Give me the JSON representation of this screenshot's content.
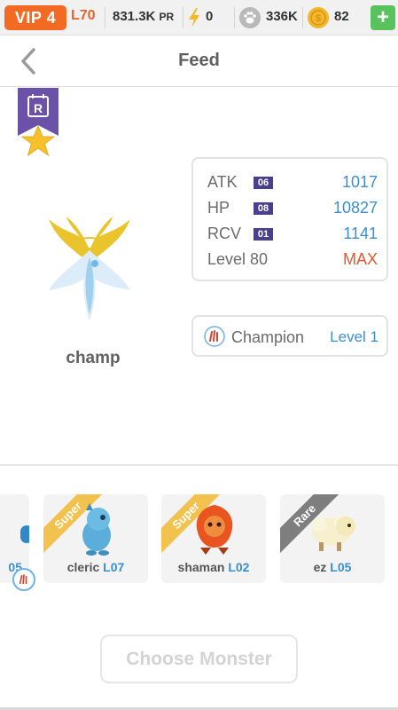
{
  "topbar": {
    "vip": "VIP 4",
    "level": "L70",
    "power": "831.3K",
    "power_suffix": "PR",
    "energy": "0",
    "paw": "336K",
    "coins": "82",
    "plus": "+"
  },
  "nav": {
    "title": "Feed"
  },
  "ribbon": {
    "letter": "R"
  },
  "monster": {
    "name": "champ"
  },
  "stats": {
    "atk": {
      "label": "ATK",
      "badge": "06",
      "value": "1017"
    },
    "hp": {
      "label": "HP",
      "badge": "08",
      "value": "10827"
    },
    "rcv": {
      "label": "RCV",
      "badge": "01",
      "value": "1141"
    },
    "level": {
      "label": "Level 80",
      "value": "MAX"
    }
  },
  "skill": {
    "name": "Champion",
    "level": "Level 1"
  },
  "cards": [
    {
      "tag": "Super",
      "name": "cleric",
      "level": "L07"
    },
    {
      "tag": "Super",
      "name": "shaman",
      "level": "L02"
    },
    {
      "tag": "Rare",
      "name": "ez",
      "level": "L05"
    }
  ],
  "partial_card": {
    "level": "05"
  },
  "choose_button": "Choose Monster",
  "colors": {
    "accent_blue": "#3a8fd0",
    "max_red": "#e4572e",
    "vip_orange": "#f36b22",
    "ribbon_purple": "#6b52a8",
    "super_gold": "#f2c14e",
    "rare_gray": "#7e7e7e"
  },
  "icons": {
    "energy": "lightning-icon",
    "paw": "paw-icon",
    "coin": "coin-icon",
    "back": "chevron-left-icon",
    "star": "star-icon",
    "skill": "claw-icon"
  }
}
